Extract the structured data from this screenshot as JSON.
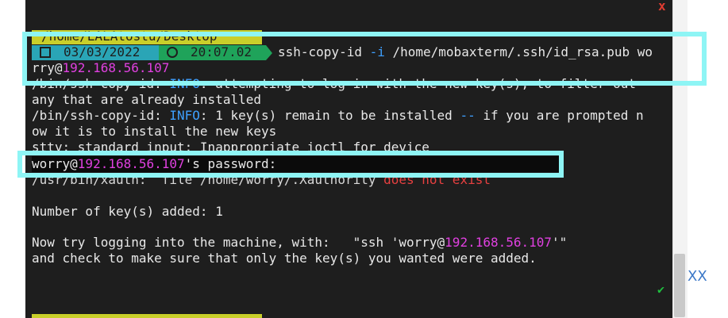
{
  "window": {
    "close_glyph": "x",
    "success_glyph": "✔",
    "side_text": "XX"
  },
  "prompt": {
    "path": "/home/LALAtostu/Desktop",
    "date": "03/03/2022",
    "time": "20:07.02",
    "command_prefix": "ssh-copy-id ",
    "command_flag": "-i",
    "command_rest": " /home/mobaxterm/.ssh/id_rsa.pub wo",
    "command_cont_user": "rry@",
    "command_cont_ip": "192.168.56.107"
  },
  "output": {
    "line1_prefix": "/bin/ssh-copy-id: ",
    "line1_info": "INFO",
    "line1_rest": ": attempting to log in with the new key(s), to filter out",
    "line2": "any that are already installed",
    "line3_prefix": "/bin/ssh-copy-id: ",
    "line3_info": "INFO",
    "line3_rest": ": 1 key(s) remain to be installed ",
    "line3_dash": "--",
    "line3_tail": " if you are prompted n",
    "line4": "ow it is to install the new keys",
    "line5": "stty: standard input: Inappropriate ioctl for device",
    "pw_user": "worry@",
    "pw_ip": "192.168.56.107",
    "pw_rest": "'s password:",
    "line7_prefix": "/usr/bin/xauth:  file /home/worry/.Xauthority ",
    "line7_red": "does not exist",
    "line8": "Number of key(s) added: 1",
    "line9_prefix": "Now try logging into the machine, with:   \"ssh 'worry@",
    "line9_ip": "192.168.56.107",
    "line9_suffix": "'\"",
    "line10": "and check to make sure that only the key(s) you wanted were added."
  },
  "colors": {
    "highlight": "#8ef5f5",
    "ip": "#e040e0",
    "info": "#3ea0ff",
    "error": "#e84040",
    "terminal_bg": "#1e1e1e"
  }
}
